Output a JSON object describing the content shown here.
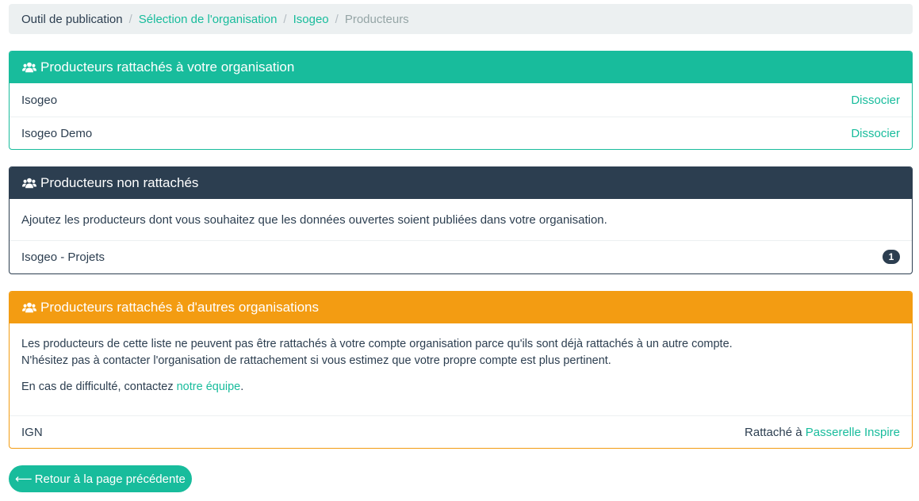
{
  "breadcrumb": {
    "items": [
      {
        "label": "Outil de publication",
        "link": false
      },
      {
        "label": "Sélection de l'organisation",
        "link": true
      },
      {
        "label": "Isogeo",
        "link": true
      },
      {
        "label": "Producteurs",
        "link": false,
        "active": true
      }
    ],
    "separator": "/"
  },
  "attached_panel": {
    "title": "Producteurs rattachés à votre organisation",
    "icon": "users-icon",
    "rows": [
      {
        "name": "Isogeo",
        "action": "Dissocier"
      },
      {
        "name": "Isogeo Demo",
        "action": "Dissocier"
      }
    ]
  },
  "unattached_panel": {
    "title": "Producteurs non rattachés",
    "icon": "users-icon",
    "description": "Ajoutez les producteurs dont vous souhaitez que les données ouvertes soient publiées dans votre organisation.",
    "rows": [
      {
        "name": "Isogeo - Projets",
        "badge": "1"
      }
    ]
  },
  "other_panel": {
    "title": "Producteurs rattachés à d'autres organisations",
    "icon": "users-icon",
    "text_line1": "Les producteurs de cette liste ne peuvent pas être rattachés à votre compte organisation parce qu'ils sont déjà rattachés à un autre compte.",
    "text_line2": "N'hésitez pas à contacter l'organisation de rattachement si vous estimez que votre propre compte est plus pertinent.",
    "contact_prefix": "En cas de difficulté, contactez ",
    "contact_link": "notre équipe",
    "contact_suffix": ".",
    "rows": [
      {
        "name": "IGN",
        "attached_prefix": "Rattaché à ",
        "attached_org": "Passerelle Inspire"
      }
    ]
  },
  "back_button": {
    "arrow": "⟵",
    "label": "Retour à la page précédente"
  },
  "colors": {
    "success": "#18bc9c",
    "primary": "#2c3e50",
    "warning": "#f39c12",
    "breadcrumb_bg": "#ecf0f1"
  }
}
